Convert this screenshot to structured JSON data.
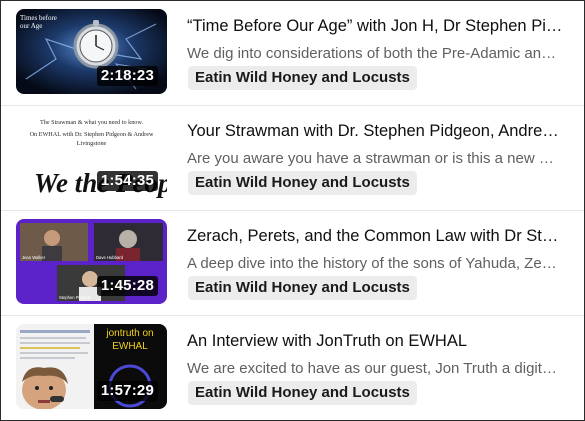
{
  "videos": [
    {
      "title": "“Time Before Our Age” with Jon H, Dr Stephen Pidgeon and Andrew Livingstone",
      "description": "We dig into considerations of both the Pre-Adamic and Post-Adamic ages",
      "channel": "Eatin Wild Honey and Locusts",
      "duration": "2:18:23",
      "thumbnail": {
        "caption_lines": [
          "Times before",
          "our Age"
        ],
        "icon": "pocket-watch-icon"
      }
    },
    {
      "title": "Your Strawman with Dr. Stephen Pidgeon, Andrew Livingstone",
      "description": "Are you aware you have a strawman or is this a new concept for you?",
      "channel": "Eatin Wild Honey and Locusts",
      "duration": "1:54:35",
      "thumbnail": {
        "caption_lines": [
          "The Strawman & what you need to know.",
          "On EWHAL with Dr. Stephen Pidgeon & Andrew",
          "Livingstone"
        ],
        "script_text": "We the People",
        "icon": "constitution-script-icon"
      }
    },
    {
      "title": "Zerach, Perets, and the Common Law with Dr Stephen Pidgeon",
      "description": "A deep dive into the history of the sons of Yahuda, Zerach and Perets",
      "channel": "Eatin Wild Honey and Locusts",
      "duration": "1:45:28",
      "thumbnail": {
        "participant_labels": [
          "Jean Walker",
          "Dave Hubbard",
          "Stephen Pidgeon"
        ],
        "icon": "video-call-grid-icon"
      }
    },
    {
      "title": "An Interview with JonTruth on EWHAL",
      "description": "We are excited to have as our guest, Jon Truth a digital creator and researcher",
      "channel": "Eatin Wild Honey and Locusts",
      "duration": "1:57:29",
      "thumbnail": {
        "caption_lines": [
          "jontruth on",
          "EWHAL"
        ],
        "icon": "guest-portrait-icon"
      }
    }
  ]
}
